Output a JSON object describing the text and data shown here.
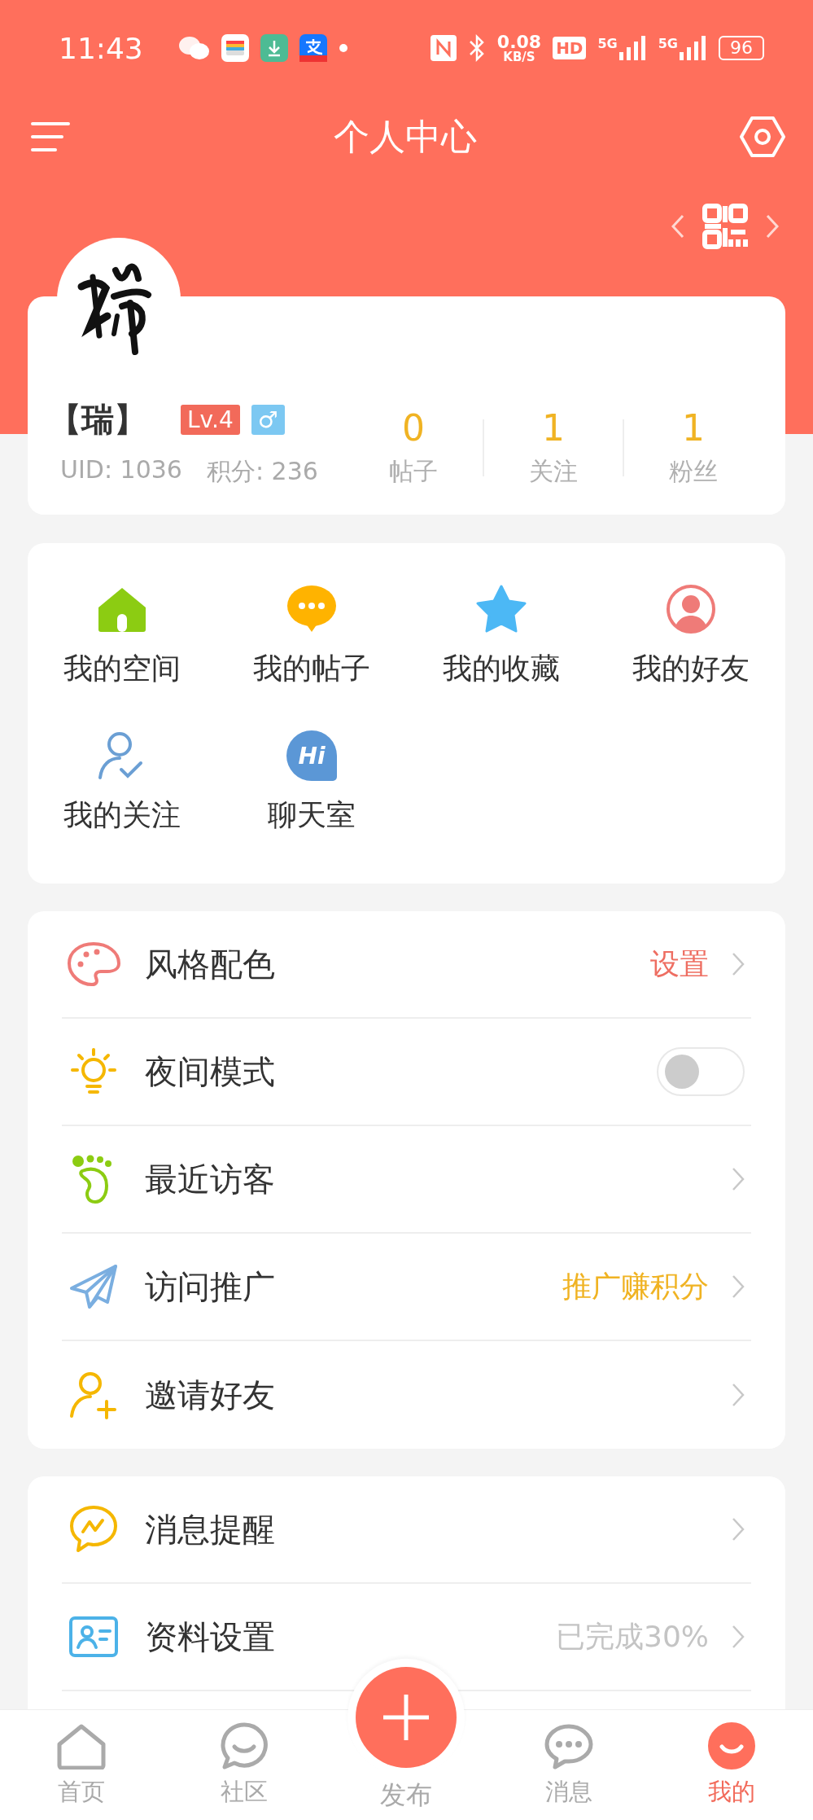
{
  "status_bar": {
    "time": "11:43",
    "net_speed": "0.08",
    "net_unit": "KB/S",
    "hd": "HD",
    "signals": [
      "5G",
      "5G"
    ],
    "battery": "96"
  },
  "header": {
    "title": "个人中心"
  },
  "profile": {
    "name": "【瑞】",
    "level": "Lv.4",
    "gender": "♂",
    "uid": "UID: 1036",
    "points": "积分: 236",
    "stats": [
      {
        "value": "0",
        "label": "帖子"
      },
      {
        "value": "1",
        "label": "关注"
      },
      {
        "value": "1",
        "label": "粉丝"
      }
    ]
  },
  "shortcuts": [
    {
      "kind": "home",
      "label": "我的空间"
    },
    {
      "kind": "posts",
      "label": "我的帖子"
    },
    {
      "kind": "star",
      "label": "我的收藏"
    },
    {
      "kind": "friend",
      "label": "我的好友"
    },
    {
      "kind": "follow",
      "label": "我的关注"
    },
    {
      "kind": "chat",
      "label": "聊天室",
      "icon_text": "Hi"
    }
  ],
  "menu_groups": [
    [
      {
        "kind": "palette",
        "label": "风格配色",
        "value": "设置",
        "color": "#ee6e62"
      },
      {
        "kind": "bulb",
        "label": "夜间模式",
        "toggle": {
          "on": false
        }
      },
      {
        "kind": "foot",
        "label": "最近访客"
      },
      {
        "kind": "plane",
        "label": "访问推广",
        "value": "推广赚积分",
        "color": "#f0b323"
      },
      {
        "kind": "invite",
        "label": "邀请好友"
      }
    ],
    [
      {
        "kind": "notice",
        "label": "消息提醒"
      },
      {
        "kind": "card",
        "label": "资料设置",
        "value": "已完成30%",
        "color": "#c4c4c4"
      }
    ]
  ],
  "tab_bar": [
    {
      "kind": "home",
      "label": "首页",
      "selected": false
    },
    {
      "kind": "community",
      "label": "社区",
      "selected": false
    },
    {
      "kind": "post",
      "label": "发布",
      "selected": false
    },
    {
      "kind": "messages",
      "label": "消息",
      "selected": false
    },
    {
      "kind": "me",
      "label": "我的",
      "selected": true
    }
  ]
}
